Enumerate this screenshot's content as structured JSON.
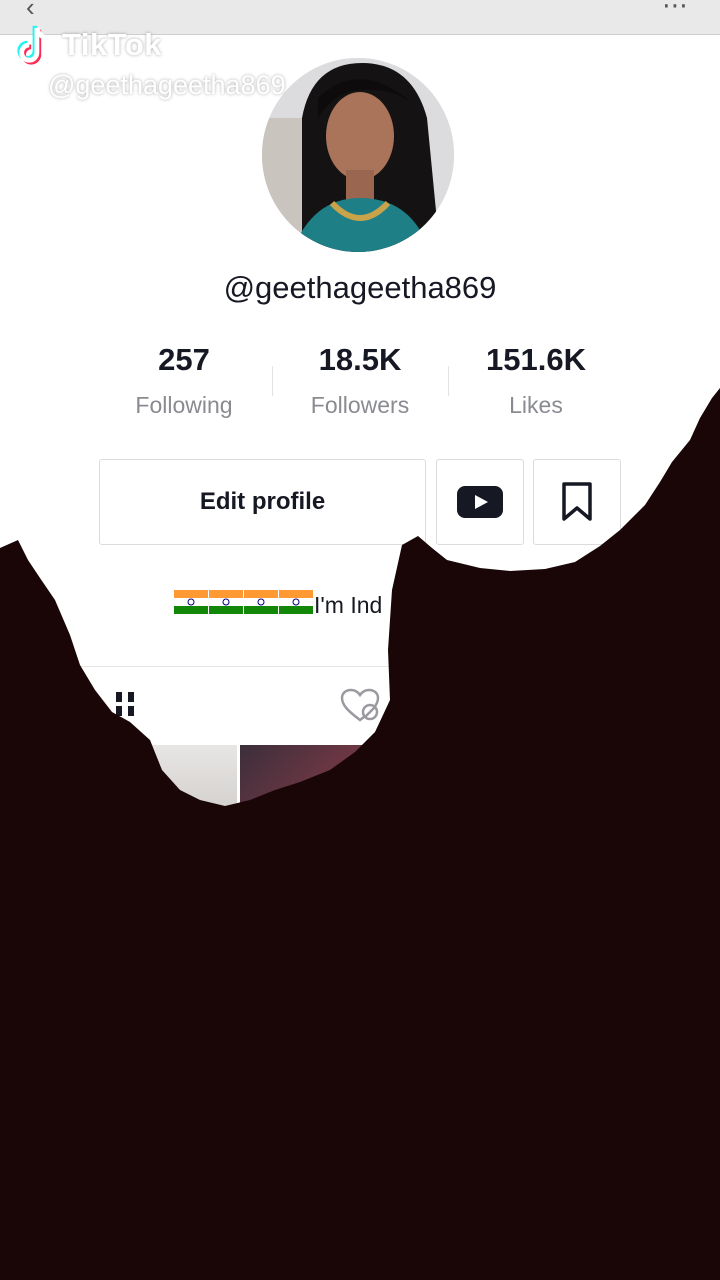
{
  "watermark": {
    "brand": "TikTok",
    "handle": "@geethageetha869"
  },
  "profile": {
    "username": "@geethageetha869",
    "stats": [
      {
        "value": "257",
        "label": "Following"
      },
      {
        "value": "18.5K",
        "label": "Followers"
      },
      {
        "value": "151.6K",
        "label": "Likes"
      }
    ],
    "edit_button": "Edit profile",
    "bio_text": "I'm Ind",
    "bio_flag_count": 4
  },
  "icons": {
    "youtube": "youtube-icon",
    "bookmark": "bookmark-icon",
    "grid": "video-grid-icon",
    "liked": "liked-videos-icon",
    "back": "back-arrow-icon",
    "more": "more-options-icon"
  },
  "colors": {
    "text": "#161823",
    "secondary": "#8a8b91",
    "overlay": "#1a0606",
    "brand_cyan": "#25F4EE",
    "brand_red": "#FE2C55"
  }
}
